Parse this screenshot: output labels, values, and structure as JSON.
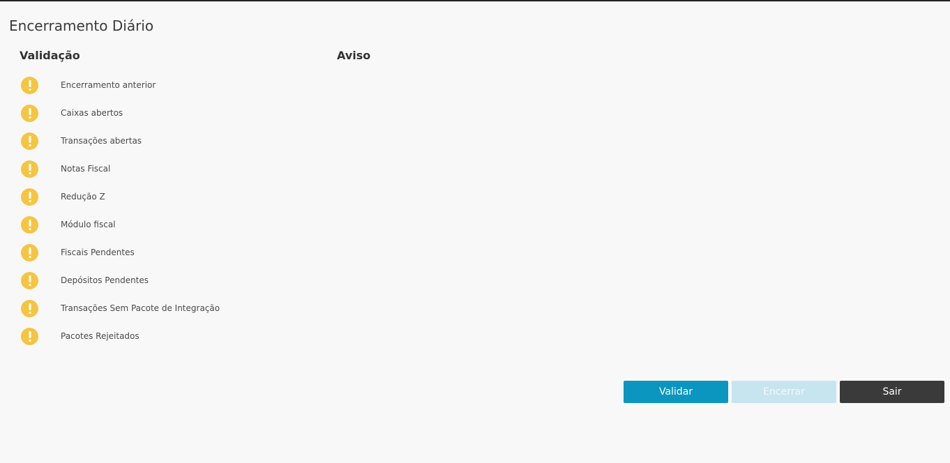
{
  "page": {
    "title": "Encerramento Diário"
  },
  "columns": {
    "validation_header": "Validação",
    "warning_header": "Aviso"
  },
  "validation_items": [
    {
      "label": "Encerramento anterior",
      "icon": "warning-icon",
      "status": "warning"
    },
    {
      "label": "Caixas abertos",
      "icon": "warning-icon",
      "status": "warning"
    },
    {
      "label": "Transações abertas",
      "icon": "warning-icon",
      "status": "warning"
    },
    {
      "label": "Notas Fiscal",
      "icon": "warning-icon",
      "status": "warning"
    },
    {
      "label": "Redução Z",
      "icon": "warning-icon",
      "status": "warning"
    },
    {
      "label": "Módulo fiscal",
      "icon": "warning-icon",
      "status": "warning"
    },
    {
      "label": "Fiscais Pendentes",
      "icon": "warning-icon",
      "status": "warning"
    },
    {
      "label": "Depósitos Pendentes",
      "icon": "warning-icon",
      "status": "warning"
    },
    {
      "label": "Transações Sem Pacote de Integração",
      "icon": "warning-icon",
      "status": "warning"
    },
    {
      "label": "Pacotes Rejeitados",
      "icon": "warning-icon",
      "status": "warning"
    }
  ],
  "buttons": {
    "validate_label": "Validar",
    "close_label": "Encerrar",
    "exit_label": "Sair"
  },
  "colors": {
    "warning": "#f5c542",
    "primary": "#0b96c0",
    "disabled": "#c6e5ef",
    "dark": "#3a3a3a"
  }
}
